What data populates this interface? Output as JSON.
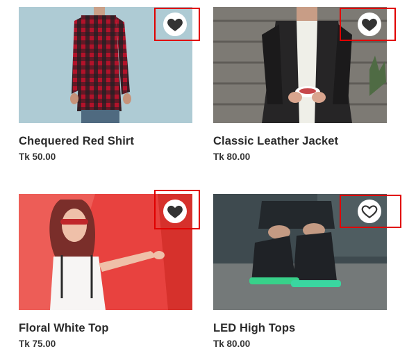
{
  "products": [
    {
      "name": "Chequered Red Shirt",
      "price": "Tk 50.00",
      "favorited": true,
      "icon": "heart-filled-icon"
    },
    {
      "name": "Classic Leather Jacket",
      "price": "Tk 80.00",
      "favorited": true,
      "icon": "heart-filled-icon"
    },
    {
      "name": "Floral White Top",
      "price": "Tk 75.00",
      "favorited": true,
      "icon": "heart-filled-icon"
    },
    {
      "name": "LED High Tops",
      "price": "Tk 80.00",
      "favorited": false,
      "icon": "heart-outline-icon"
    }
  ],
  "colors": {
    "highlight": "#e00000",
    "heart": "#333333"
  }
}
